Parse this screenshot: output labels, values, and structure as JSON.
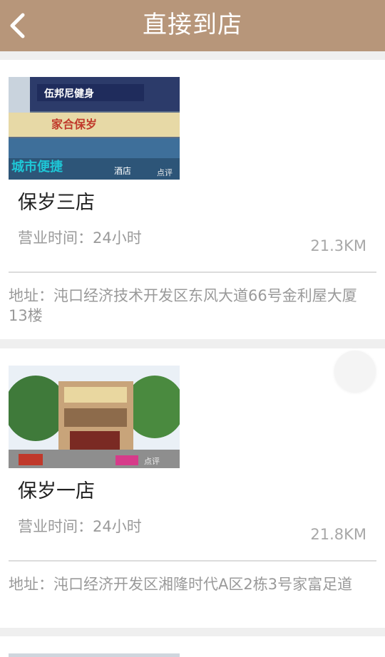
{
  "header": {
    "title": "直接到店",
    "back_icon": "chevron-left-icon"
  },
  "colors": {
    "header_bg": "#b7967a",
    "page_bg": "#efefef",
    "card_bg": "#ffffff",
    "muted_text": "#9a9a9a"
  },
  "stores": [
    {
      "name": "保岁三店",
      "hours": "营业时间：24小时",
      "distance": "21.3KM",
      "address": "地址：沌口经济技术开发区东风大道66号金利屋大厦13楼",
      "photo_signs": [
        "家合保岁",
        "城市便捷",
        "酒店",
        "点评"
      ]
    },
    {
      "name": "保岁一店",
      "hours": "营业时间：24小时",
      "distance": "21.8KM",
      "address": "地址：沌口经济开发区湘隆时代A区2栋3号家富足道",
      "photo_signs": [
        "点评"
      ]
    }
  ]
}
